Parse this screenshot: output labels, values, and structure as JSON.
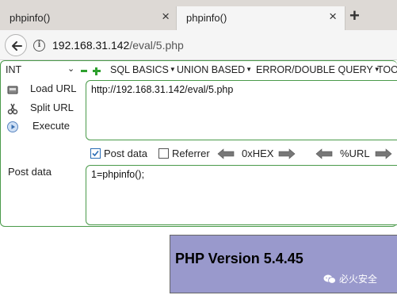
{
  "tabs": [
    {
      "title": "phpinfo()",
      "active": false
    },
    {
      "title": "phpinfo()",
      "active": true
    }
  ],
  "tab_close_glyph": "×",
  "new_tab_glyph": "+",
  "address": {
    "host": "192.168.31.142",
    "path": "/eval/5.php"
  },
  "hackbar": {
    "select_value": "INT",
    "menu": [
      "SQL BASICS",
      "UNION BASED",
      "ERROR/DOUBLE QUERY",
      "TOOLS"
    ],
    "actions": {
      "load": "Load URL",
      "split": "Split URL",
      "execute": "Execute"
    },
    "url_value": "http://192.168.31.142/eval/5.php",
    "options": {
      "post_data": {
        "label": "Post data",
        "checked": true
      },
      "referrer": {
        "label": "Referrer",
        "checked": false
      },
      "hex": "0xHEX",
      "url_enc": "%URL"
    },
    "post_label": "Post data",
    "post_value": "1=phpinfo();"
  },
  "page": {
    "php_version": "PHP Version 5.4.45"
  },
  "watermark": {
    "text": "必火安全"
  },
  "colors": {
    "accent_green": "#4a9a4a",
    "php_header_bg": "#9999cc",
    "tab_bar_bg": "#ddd9d5"
  }
}
